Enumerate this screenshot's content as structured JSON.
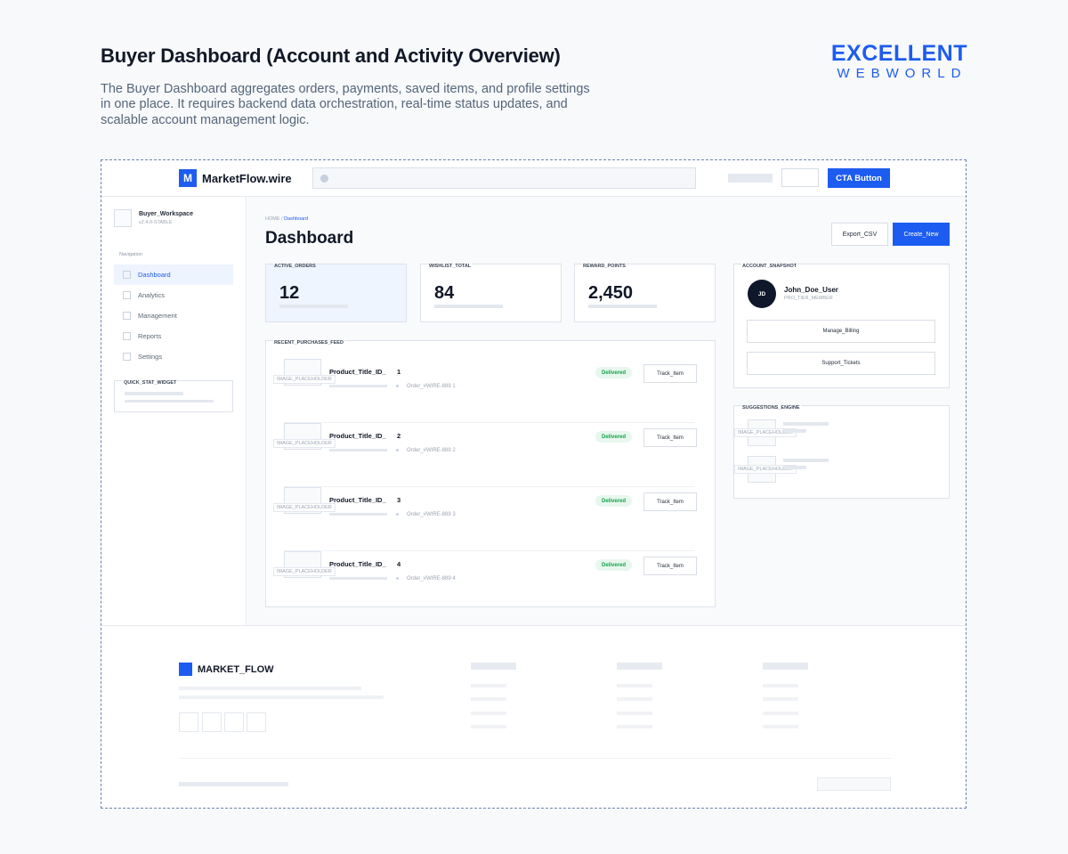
{
  "header": {
    "title": "Buyer Dashboard (Account and Activity Overview)",
    "description": "The Buyer Dashboard aggregates orders, payments, saved items, and profile settings in one place. It requires backend data orchestration, real-time status updates, and scalable account management logic."
  },
  "brand": {
    "top": "EXCELLENT",
    "bottom": "WEBWORLD",
    "color": "#1d5cf0"
  },
  "topbar": {
    "logo_mark": "M",
    "logo_text": "MarketFlow.wire",
    "cta_label": "CTA Button"
  },
  "sidebar": {
    "workspace_name": "Buyer_Workspace",
    "workspace_version": "v2.4.0-STABLE",
    "nav_title": "Navigation",
    "items": [
      {
        "label": "Dashboard",
        "active": true
      },
      {
        "label": "Analytics"
      },
      {
        "label": "Management"
      },
      {
        "label": "Reports"
      },
      {
        "label": "Settings"
      }
    ],
    "widget_label": "QUICK_STAT_WIDGET"
  },
  "main": {
    "breadcrumb_home": "HOME /",
    "breadcrumb_current": "Dashboard",
    "title": "Dashboard",
    "export_label": "Export_CSV",
    "create_label": "Create_New",
    "stats": [
      {
        "label": "ACTIVE_ORDERS",
        "value": "12"
      },
      {
        "label": "WISHLIST_TOTAL",
        "value": "84"
      },
      {
        "label": "REWARD_POINTS",
        "value": "2,450"
      }
    ],
    "feed_label": "RECENT_PURCHASES_FEED",
    "image_placeholder": "IMAGE_PLACEHOLDER",
    "purchases": [
      {
        "title": "Product_Title_ID_",
        "num": "1",
        "order": "Order_#WIRE-889 1",
        "status": "Delivered",
        "action": "Track_Item"
      },
      {
        "title": "Product_Title_ID_",
        "num": "2",
        "order": "Order_#WIRE-889 2",
        "status": "Delivered",
        "action": "Track_Item"
      },
      {
        "title": "Product_Title_ID_",
        "num": "3",
        "order": "Order_#WIRE-889 3",
        "status": "Delivered",
        "action": "Track_Item"
      },
      {
        "title": "Product_Title_ID_",
        "num": "4",
        "order": "Order_#WIRE-889 4",
        "status": "Delivered",
        "action": "Track_Item"
      }
    ]
  },
  "snapshot": {
    "label": "ACCOUNT_SNAPSHOT",
    "initials": "JD",
    "user_name": "John_Doe_User",
    "tier": "PRO_TIER_MEMBER",
    "billing_label": "Manage_Billing",
    "support_label": "Support_Tickets"
  },
  "suggestions": {
    "label": "SUGGESTIONS_ENGINE",
    "image_placeholder": "IMAGE_PLACEHOLDER"
  },
  "footer": {
    "brand": "MARKET_FLOW"
  }
}
